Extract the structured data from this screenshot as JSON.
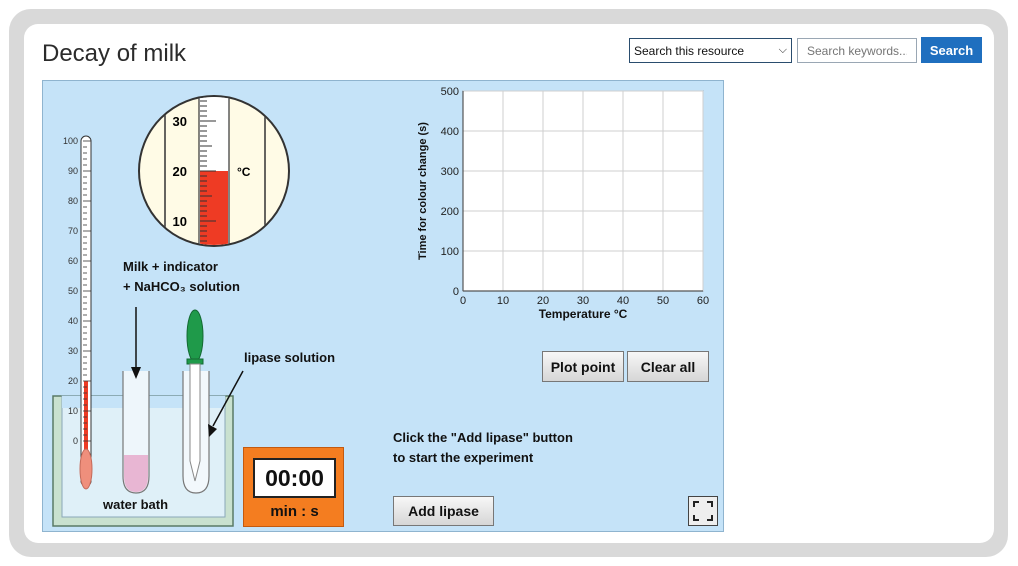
{
  "page": {
    "title": "Decay of milk"
  },
  "search": {
    "scope_selected": "Search this resource",
    "placeholder": "Search keywords...",
    "button_label": "Search"
  },
  "apparatus": {
    "thermometer_scale": [
      "100",
      "90",
      "80",
      "70",
      "60",
      "50",
      "40",
      "30",
      "20",
      "10",
      "0"
    ],
    "magnifier_scale": [
      "30",
      "20",
      "10"
    ],
    "magnifier_unit": "°C",
    "thermometer_reading": 20,
    "milk_label_line1": "Milk  + indicator",
    "milk_label_line2": "+ NaHCO₃ solution",
    "lipase_label": "lipase solution",
    "water_bath_label": "water bath"
  },
  "timer": {
    "display": "00:00",
    "unit": "min : s"
  },
  "instructions": {
    "line1": "Click the \"Add lipase\" button",
    "line2": "to start the experiment"
  },
  "buttons": {
    "plot_point": "Plot point",
    "clear_all": "Clear all",
    "add_lipase": "Add lipase"
  },
  "colors": {
    "sim_background": "#c5e3f8",
    "mercury": "#ee3b24",
    "milk": "#e8b6d3",
    "bulb": "#ef8f7c",
    "dropper": "#1f9a4a",
    "timer": "#f47d20",
    "search_button": "#1f6fbf"
  },
  "chart_data": {
    "type": "scatter",
    "title": "",
    "xlabel": "Temperature °C",
    "ylabel": "Time for colour change (s)",
    "xlim": [
      0,
      60
    ],
    "ylim": [
      0,
      500
    ],
    "xticks": [
      0,
      10,
      20,
      30,
      40,
      50,
      60
    ],
    "yticks": [
      0,
      100,
      200,
      300,
      400,
      500
    ],
    "grid": true,
    "series": []
  }
}
